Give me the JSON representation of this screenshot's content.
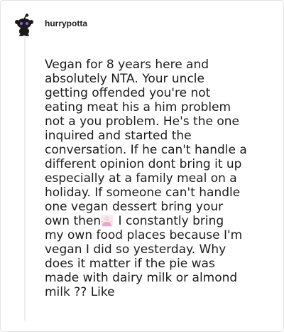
{
  "comment": {
    "username": "hurrypotta",
    "avatar_icon": "snoo-avatar-icon",
    "text_part1": "Vegan for 8 years here and\nabsolutely NTA. Your uncle\ngetting offended you're not\neating meat his a him problem\nnot a you problem. He's the one\ninquired and started the\nconversation. If he can't handle a\ndifferent opinion dont bring it up\nespecially at a family meal on a\nholiday. If someone can't handle\none vegan dessert bring your\nown then",
    "emoji_icon": "woman-shrugging-emoji",
    "text_part2": " I constantly bring\nmy own food places because I'm\nvegan I did so yesterday. Why\ndoes it matter if the pie was\nmade with dairy milk or almond\nmilk ?? Like",
    "colors": {
      "text": "#1c1c1c",
      "border": "#e4e4e4",
      "thread_line": "#ececec"
    }
  }
}
